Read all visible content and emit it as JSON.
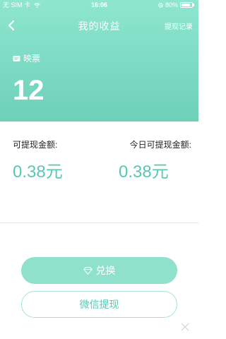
{
  "status_bar": {
    "carrier": "无 SIM 卡",
    "time": "16:06",
    "battery": "80%"
  },
  "nav": {
    "title": "我的收益",
    "right_link": "提现记录"
  },
  "tickets": {
    "label": "映票",
    "count": "12"
  },
  "earnings": {
    "withdrawable_label": "可提现金额:",
    "withdrawable_value": "0.38元",
    "today_label": "今日可提现金额:",
    "today_value": "0.38元"
  },
  "actions": {
    "exchange_label": "兑换",
    "withdraw_label": "微信提现"
  },
  "colors": {
    "header_gradient_top": "#8ee6d0",
    "header_gradient_bottom": "#6ed0b8",
    "accent": "#57c8b3",
    "exchange_button": "#8fe0cc"
  },
  "icons": [
    "back-chevron-icon",
    "wifi-icon",
    "location-icon",
    "battery-icon",
    "ticket-icon",
    "diamond-icon"
  ]
}
